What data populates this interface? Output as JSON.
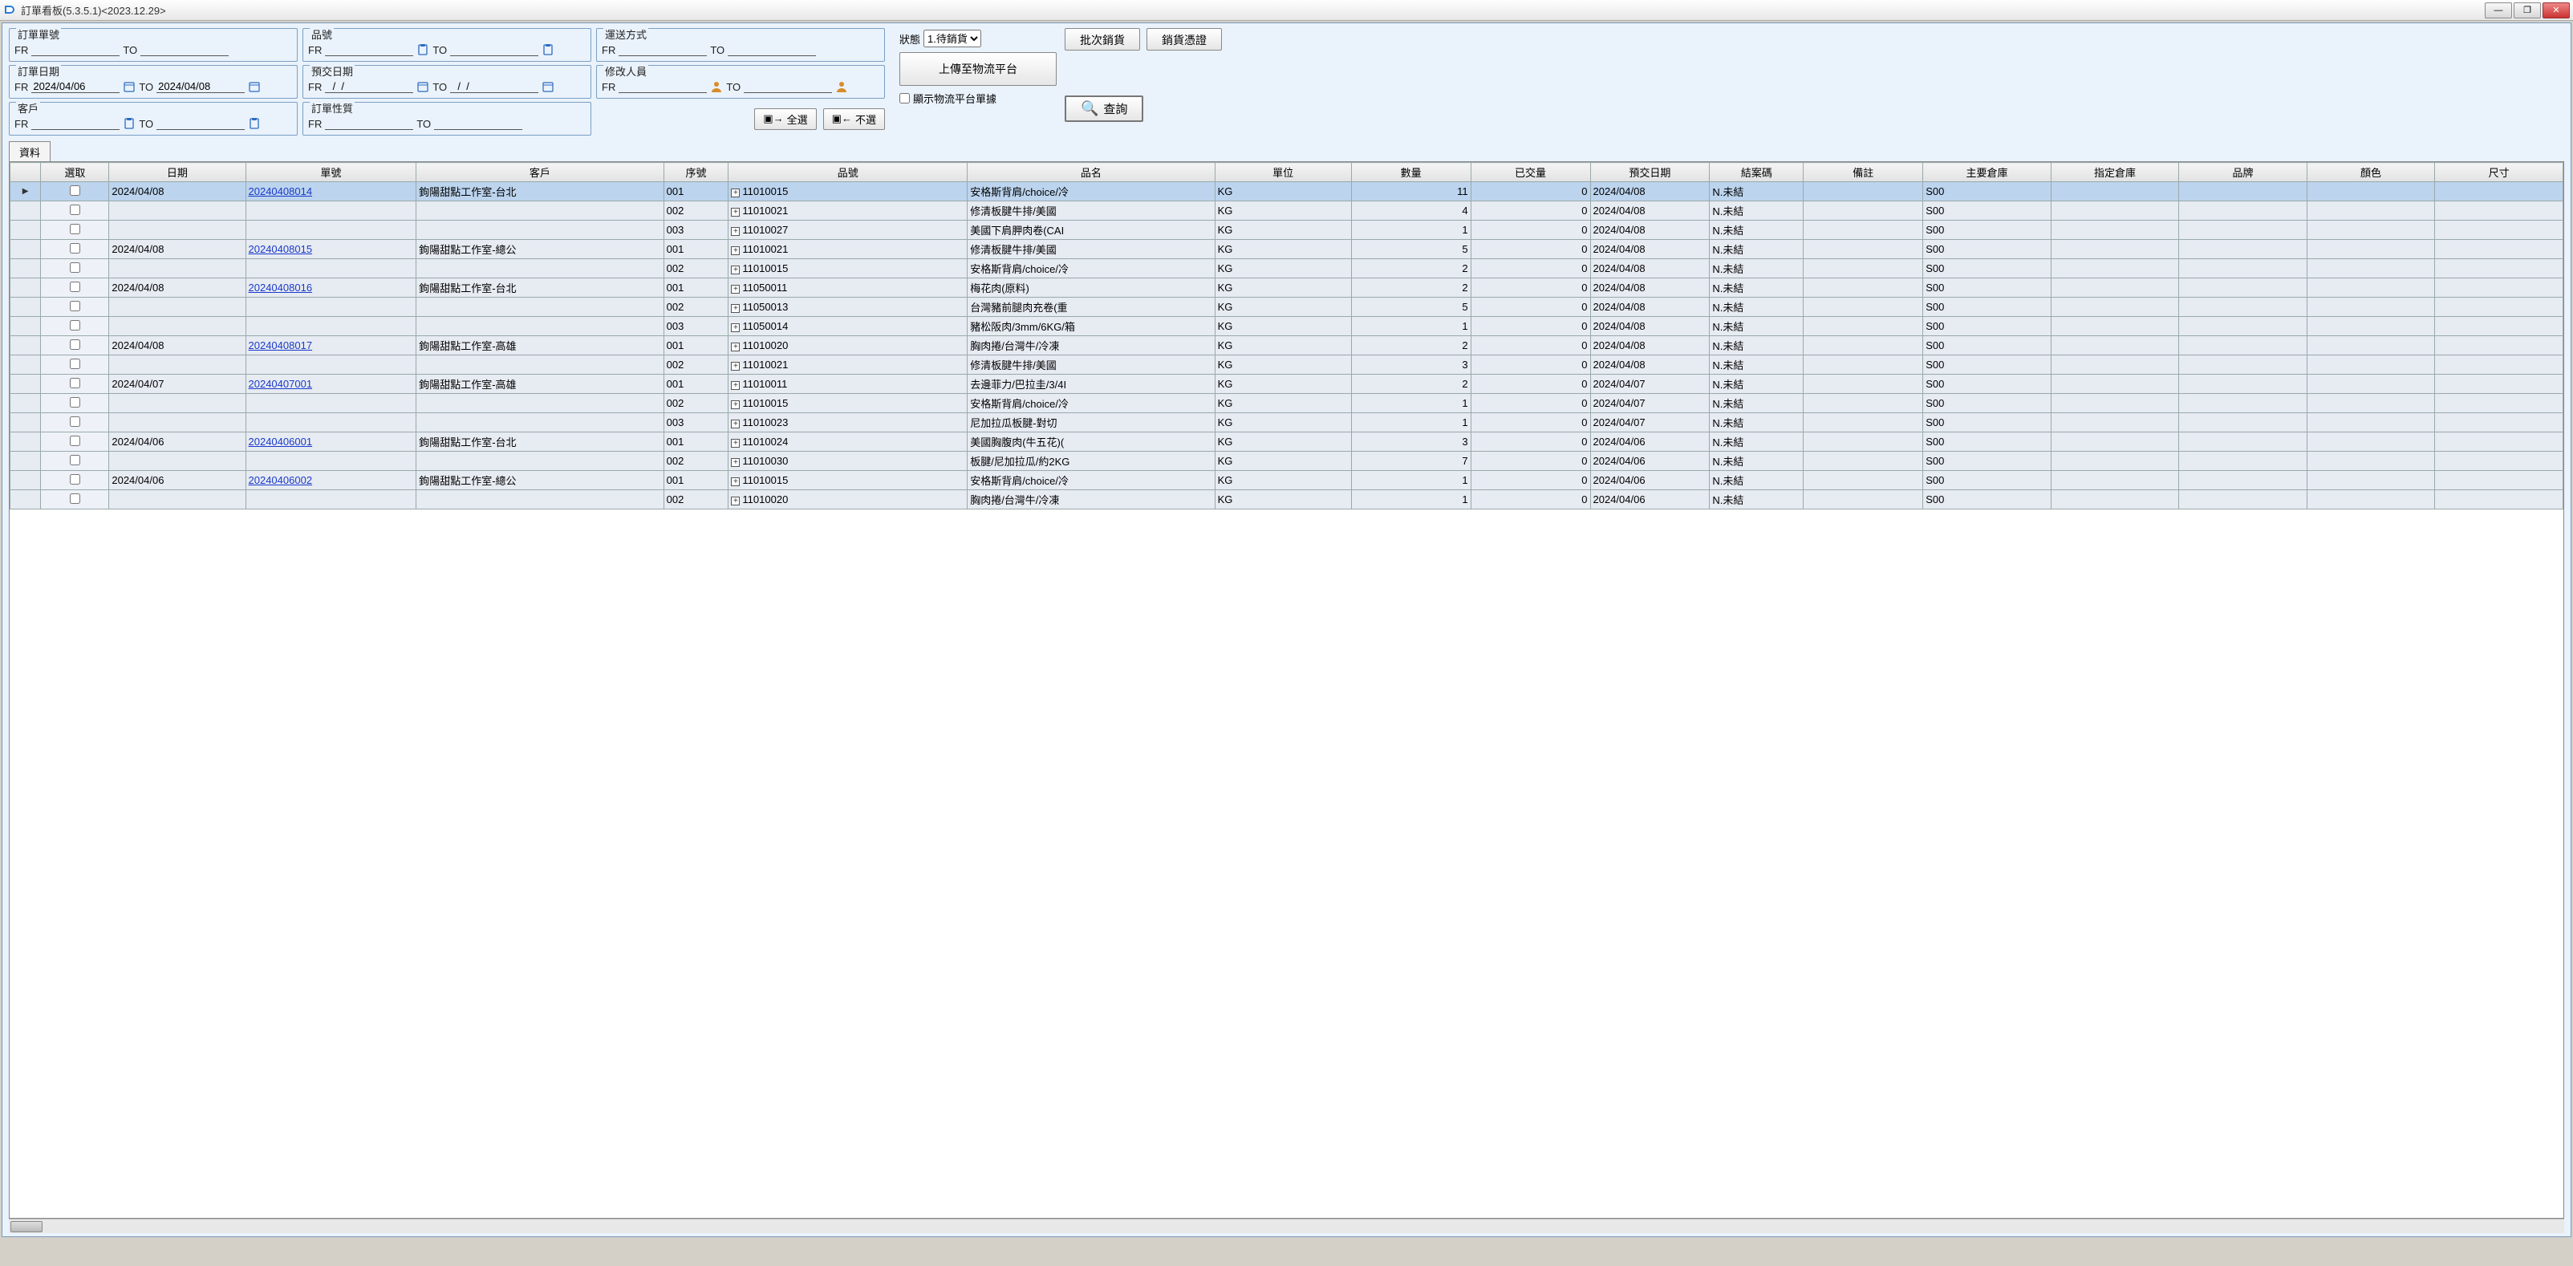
{
  "window": {
    "title": "訂單看板(5.3.5.1)<2023.12.29>"
  },
  "filters": {
    "orderNo": {
      "label": "訂單單號",
      "fr": "FR",
      "to": "TO"
    },
    "product": {
      "label": "品號",
      "fr": "FR",
      "to": "TO"
    },
    "shipping": {
      "label": "運送方式",
      "fr": "FR",
      "to": "TO"
    },
    "orderDate": {
      "label": "訂單日期",
      "fr": "FR",
      "frVal": "2024/04/06",
      "to": "TO",
      "toVal": "2024/04/08"
    },
    "dueDate": {
      "label": "預交日期",
      "fr": "FR",
      "frVal": "  /  /",
      "to": "TO",
      "toVal": "  /  /"
    },
    "modifier": {
      "label": "修改人員",
      "fr": "FR",
      "to": "TO"
    },
    "customer": {
      "label": "客戶",
      "fr": "FR",
      "to": "TO"
    },
    "orderType": {
      "label": "訂單性質",
      "fr": "FR",
      "to": "TO"
    }
  },
  "right": {
    "statusLabel": "狀態",
    "statusValue": "1.待銷貨",
    "batchShip": "批次銷貨",
    "salesDoc": "銷貨憑證",
    "uploadLogistics": "上傳至物流平台",
    "selectAll": "全選",
    "deselectAll": "不選",
    "showLogistics": "顯示物流平台單據",
    "search": "查詢"
  },
  "tab": "資料",
  "columns": [
    "選取",
    "日期",
    "單號",
    "客戶",
    "序號",
    "品號",
    "品名",
    "單位",
    "數量",
    "已交量",
    "預交日期",
    "結案碼",
    "備註",
    "主要倉庫",
    "指定倉庫",
    "品牌",
    "顏色",
    "尺寸"
  ],
  "rows": [
    {
      "sel": true,
      "chk": false,
      "date": "2024/04/08",
      "ord": "20240408014",
      "cust": "鉤陽甜點工作室-台北",
      "seq": "001",
      "pn": "11010015",
      "name": "安格斯背肩/choice/冷",
      "unit": "KG",
      "qty": "11",
      "dly": "0",
      "ddate": "2024/04/08",
      "close": "N.未結",
      "wh": "S00"
    },
    {
      "chk": false,
      "seq": "002",
      "pn": "11010021",
      "name": "修清板腱牛排/美國",
      "unit": "KG",
      "qty": "4",
      "dly": "0",
      "ddate": "2024/04/08",
      "close": "N.未結",
      "wh": "S00"
    },
    {
      "chk": false,
      "seq": "003",
      "pn": "11010027",
      "name": "美國下肩胛肉卷(CAI",
      "unit": "KG",
      "qty": "1",
      "dly": "0",
      "ddate": "2024/04/08",
      "close": "N.未結",
      "wh": "S00"
    },
    {
      "chk": false,
      "date": "2024/04/08",
      "ord": "20240408015",
      "cust": "鉤陽甜點工作室-總公",
      "seq": "001",
      "pn": "11010021",
      "name": "修清板腱牛排/美國",
      "unit": "KG",
      "qty": "5",
      "dly": "0",
      "ddate": "2024/04/08",
      "close": "N.未結",
      "wh": "S00"
    },
    {
      "chk": false,
      "seq": "002",
      "pn": "11010015",
      "name": "安格斯背肩/choice/冷",
      "unit": "KG",
      "qty": "2",
      "dly": "0",
      "ddate": "2024/04/08",
      "close": "N.未結",
      "wh": "S00"
    },
    {
      "chk": false,
      "date": "2024/04/08",
      "ord": "20240408016",
      "cust": "鉤陽甜點工作室-台北",
      "seq": "001",
      "pn": "11050011",
      "name": "梅花肉(原料)",
      "unit": "KG",
      "qty": "2",
      "dly": "0",
      "ddate": "2024/04/08",
      "close": "N.未結",
      "wh": "S00"
    },
    {
      "chk": false,
      "seq": "002",
      "pn": "11050013",
      "name": "台灣豬前腿肉充卷(重",
      "unit": "KG",
      "qty": "5",
      "dly": "0",
      "ddate": "2024/04/08",
      "close": "N.未結",
      "wh": "S00"
    },
    {
      "chk": false,
      "seq": "003",
      "pn": "11050014",
      "name": "豬松阪肉/3mm/6KG/箱",
      "unit": "KG",
      "qty": "1",
      "dly": "0",
      "ddate": "2024/04/08",
      "close": "N.未結",
      "wh": "S00"
    },
    {
      "chk": false,
      "date": "2024/04/08",
      "ord": "20240408017",
      "cust": "鉤陽甜點工作室-高雄",
      "seq": "001",
      "pn": "11010020",
      "name": "胸肉捲/台灣牛/冷凍",
      "unit": "KG",
      "qty": "2",
      "dly": "0",
      "ddate": "2024/04/08",
      "close": "N.未結",
      "wh": "S00"
    },
    {
      "chk": false,
      "seq": "002",
      "pn": "11010021",
      "name": "修清板腱牛排/美國",
      "unit": "KG",
      "qty": "3",
      "dly": "0",
      "ddate": "2024/04/08",
      "close": "N.未結",
      "wh": "S00"
    },
    {
      "chk": false,
      "date": "2024/04/07",
      "ord": "20240407001",
      "cust": "鉤陽甜點工作室-高雄",
      "seq": "001",
      "pn": "11010011",
      "name": "去邊菲力/巴拉圭/3/4I",
      "unit": "KG",
      "qty": "2",
      "dly": "0",
      "ddate": "2024/04/07",
      "close": "N.未結",
      "wh": "S00"
    },
    {
      "chk": false,
      "seq": "002",
      "pn": "11010015",
      "name": "安格斯背肩/choice/冷",
      "unit": "KG",
      "qty": "1",
      "dly": "0",
      "ddate": "2024/04/07",
      "close": "N.未結",
      "wh": "S00"
    },
    {
      "chk": false,
      "seq": "003",
      "pn": "11010023",
      "name": "尼加拉瓜板腱-對切",
      "unit": "KG",
      "qty": "1",
      "dly": "0",
      "ddate": "2024/04/07",
      "close": "N.未結",
      "wh": "S00"
    },
    {
      "chk": false,
      "date": "2024/04/06",
      "ord": "20240406001",
      "cust": "鉤陽甜點工作室-台北",
      "seq": "001",
      "pn": "11010024",
      "name": "美國胸腹肉(牛五花)(",
      "unit": "KG",
      "qty": "3",
      "dly": "0",
      "ddate": "2024/04/06",
      "close": "N.未結",
      "wh": "S00"
    },
    {
      "chk": false,
      "seq": "002",
      "pn": "11010030",
      "name": "板腱/尼加拉瓜/約2KG",
      "unit": "KG",
      "qty": "7",
      "dly": "0",
      "ddate": "2024/04/06",
      "close": "N.未結",
      "wh": "S00"
    },
    {
      "chk": false,
      "date": "2024/04/06",
      "ord": "20240406002",
      "cust": "鉤陽甜點工作室-總公",
      "seq": "001",
      "pn": "11010015",
      "name": "安格斯背肩/choice/冷",
      "unit": "KG",
      "qty": "1",
      "dly": "0",
      "ddate": "2024/04/06",
      "close": "N.未結",
      "wh": "S00"
    },
    {
      "chk": false,
      "seq": "002",
      "pn": "11010020",
      "name": "胸肉捲/台灣牛/冷凍",
      "unit": "KG",
      "qty": "1",
      "dly": "0",
      "ddate": "2024/04/06",
      "close": "N.未結",
      "wh": "S00"
    }
  ]
}
